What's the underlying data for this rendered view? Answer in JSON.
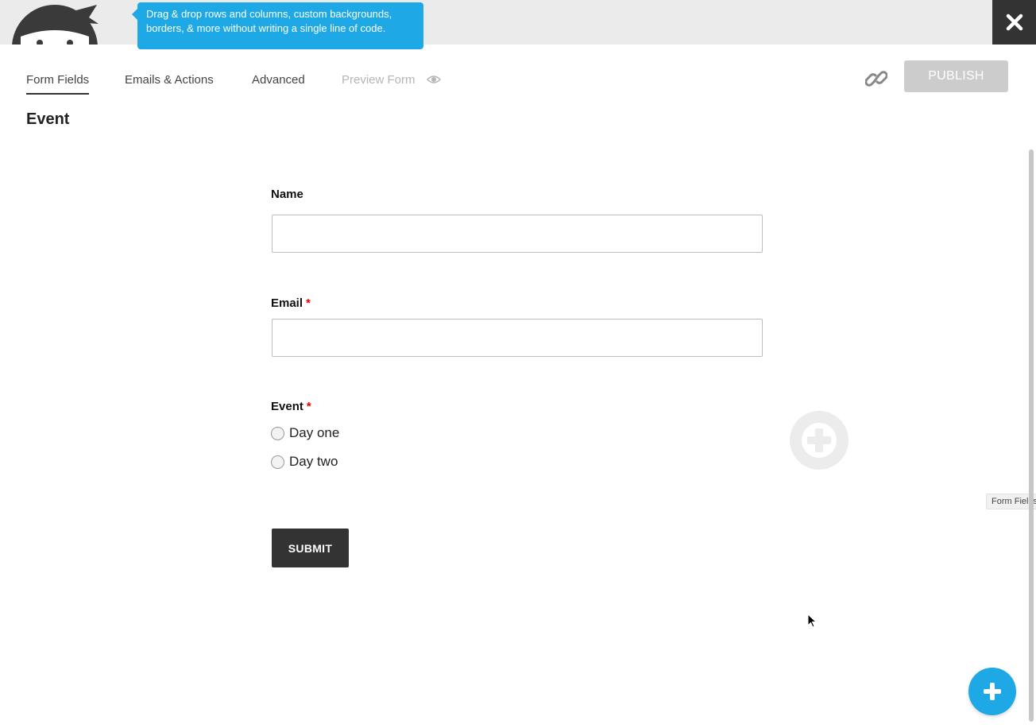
{
  "header": {
    "logo_icon": "ninja-logo-icon",
    "tooltip_text": "Drag & drop rows and columns, custom backgrounds, borders, & more without writing a single line of code.",
    "close_icon": "close-icon"
  },
  "tabs": [
    {
      "label": "Form Fields",
      "active": true
    },
    {
      "label": "Emails & Actions",
      "active": false
    },
    {
      "label": "Advanced",
      "active": false
    },
    {
      "label": "Preview Form",
      "active": false,
      "icon": "eye-icon"
    }
  ],
  "toolbar": {
    "link_icon": "link-icon",
    "publish_label": "PUBLISH"
  },
  "form": {
    "title": "Event",
    "fields": [
      {
        "label": "Name",
        "type": "text",
        "required": false,
        "value": ""
      },
      {
        "label": "Email",
        "type": "email",
        "required": true,
        "value": ""
      },
      {
        "label": "Event",
        "type": "radio",
        "required": true,
        "options": [
          "Day one",
          "Day two"
        ]
      }
    ],
    "required_marker": "*",
    "submit_label": "SUBMIT"
  },
  "side_panel": {
    "label": "Form Fields"
  },
  "colors": {
    "accent": "#1ea9e6",
    "dark": "#333333",
    "publish_disabled": "#cccccc",
    "required": "#ee0000"
  }
}
